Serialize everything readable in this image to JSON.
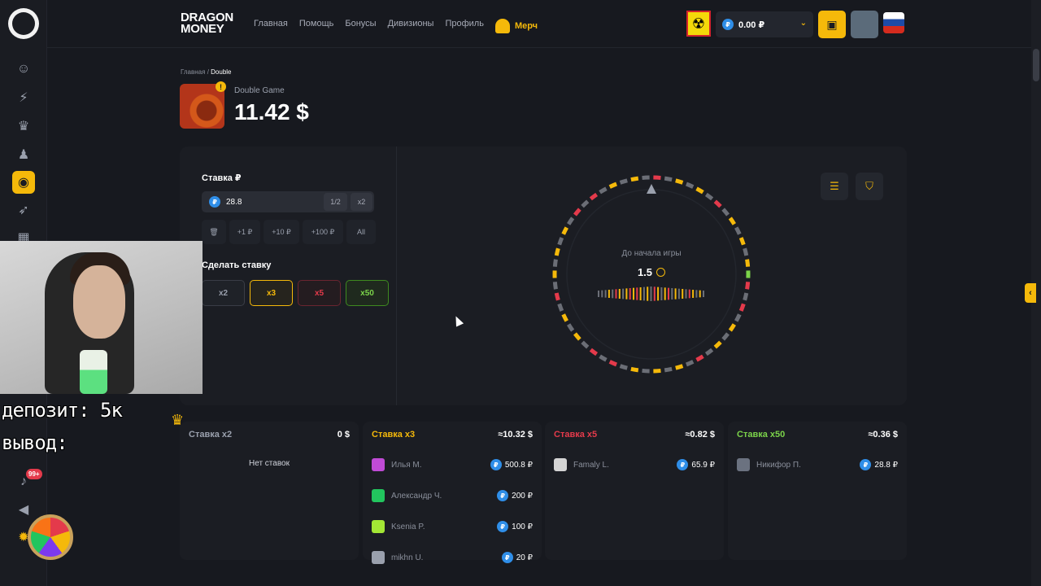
{
  "brand": {
    "line1": "DRAGON",
    "line2": "MONEY"
  },
  "nav": [
    "Главная",
    "Помощь",
    "Бонусы",
    "Дивизионы",
    "Профиль"
  ],
  "merch": "Мерч",
  "balance": {
    "currency": "₽",
    "value": "0.00 ₽"
  },
  "breadcrumb": {
    "home": "Главная",
    "sep": "/",
    "current": "Double"
  },
  "game": {
    "subtitle": "Double Game",
    "amount": "11.42 $"
  },
  "bet_panel": {
    "label": "Ставка ₽",
    "value": "28.8",
    "half": "1/2",
    "double": "x2",
    "chips": [
      "+1 ₽",
      "+10 ₽",
      "+100 ₽",
      "All"
    ],
    "make_label": "Сделать ставку",
    "multipliers": [
      "x2",
      "x3",
      "x5",
      "x50"
    ]
  },
  "wheel": {
    "countdown_label": "До начала игры",
    "countdown": "1.5"
  },
  "columns": [
    {
      "title": "Ставка x2",
      "total": "0 $",
      "color": "#9aa0ad",
      "empty": "Нет ставок",
      "rows": []
    },
    {
      "title": "Ставка x3",
      "total": "≈10.32 $",
      "color": "#f5b90a",
      "rows": [
        {
          "name": "Илья М.",
          "amount": "500.8 ₽",
          "ava": "#c04bd6"
        },
        {
          "name": "Александр Ч.",
          "amount": "200 ₽",
          "ava": "#22c55e"
        },
        {
          "name": "Ksenia P.",
          "amount": "100 ₽",
          "ava": "#a3e635"
        },
        {
          "name": "mikhn U.",
          "amount": "20 ₽",
          "ava": "#9aa0ad"
        }
      ]
    },
    {
      "title": "Ставка x5",
      "total": "≈0.82 $",
      "color": "#e43a4b",
      "rows": [
        {
          "name": "Famaly L.",
          "amount": "65.9 ₽",
          "ava": "#d4d4d4"
        }
      ]
    },
    {
      "title": "Ставка x50",
      "total": "≈0.36 $",
      "color": "#7bd34a",
      "rows": [
        {
          "name": "Никифор П.",
          "amount": "28.8 ₽",
          "ava": "#6b7280"
        }
      ]
    }
  ],
  "overlay": {
    "line1": "депозит: 5к",
    "line2": "вывод:"
  },
  "notifications_badge": "99+",
  "colors": {
    "accent": "#f5b90a",
    "red": "#e43a4b",
    "green": "#7bd34a",
    "grey": "#6b6e76"
  }
}
